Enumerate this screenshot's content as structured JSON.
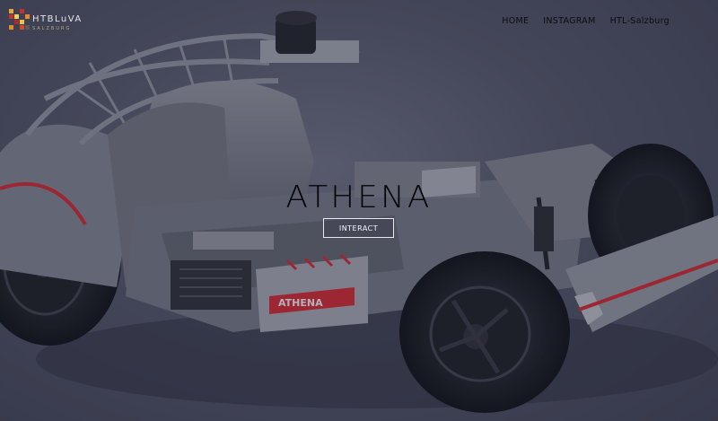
{
  "header": {
    "logo": {
      "name": "HTBLuVA",
      "subtitle": "SALZBURG",
      "colors": [
        "#e8a53a",
        "#c8312b",
        "#e7c64a",
        "#5a5a5a",
        "#d24a2a",
        "#f0d060",
        "#b32a25",
        "#e88a2c"
      ]
    },
    "nav": [
      {
        "label": "HOME"
      },
      {
        "label": "INSTAGRAM"
      },
      {
        "label": "HTL-Salzburg"
      }
    ]
  },
  "hero": {
    "title": "ATHENA",
    "button_label": "INTERACT",
    "image": "race-car-chassis-render",
    "chassis_label": "ATHENA",
    "accent_color": "#c9262d"
  }
}
